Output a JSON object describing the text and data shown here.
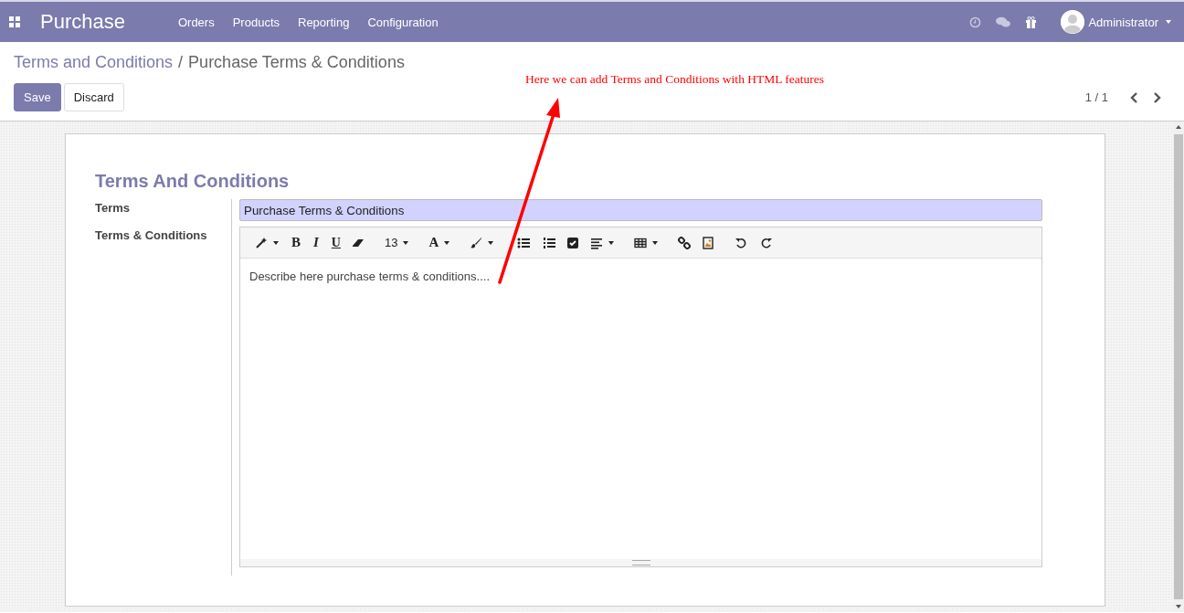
{
  "navbar": {
    "app_name": "Purchase",
    "menus": [
      "Orders",
      "Products",
      "Reporting",
      "Configuration"
    ],
    "user": "Administrator"
  },
  "breadcrumb": {
    "parent": "Terms and Conditions",
    "separator": "/",
    "current": "Purchase Terms & Conditions"
  },
  "buttons": [
    {
      "label": "Save",
      "kind": "primary"
    },
    {
      "label": "Discard",
      "kind": "secondary"
    }
  ],
  "pager": {
    "text": "1 / 1"
  },
  "annotation": {
    "text": "Here we can add Terms and Conditions with HTML features"
  },
  "form": {
    "title": "Terms And Conditions",
    "fields": [
      {
        "label": "Terms",
        "kind": "input",
        "value": "Purchase Terms & Conditions"
      },
      {
        "label": "Terms & Conditions",
        "kind": "html",
        "value": "Describe here purchase terms & conditions...."
      }
    ],
    "toolbar": [
      {
        "kind": "wand",
        "dropdown": true
      },
      {
        "kind": "bold",
        "label": "B"
      },
      {
        "kind": "italic",
        "label": "I"
      },
      {
        "kind": "underline",
        "label": "U"
      },
      {
        "kind": "eraser",
        "dropdown": false
      },
      {
        "kind": "size",
        "label": "13",
        "dropdown": true
      },
      {
        "kind": "color",
        "label": "A",
        "dropdown": true
      },
      {
        "kind": "brush",
        "dropdown": true
      },
      {
        "kind": "ul",
        "dropdown": false
      },
      {
        "kind": "ol",
        "dropdown": false
      },
      {
        "kind": "check",
        "dropdown": false
      },
      {
        "kind": "align",
        "dropdown": true
      },
      {
        "kind": "table",
        "dropdown": true
      },
      {
        "kind": "link",
        "dropdown": false
      },
      {
        "kind": "image",
        "dropdown": false
      },
      {
        "kind": "undo",
        "dropdown": false
      },
      {
        "kind": "redo",
        "dropdown": false
      }
    ]
  }
}
